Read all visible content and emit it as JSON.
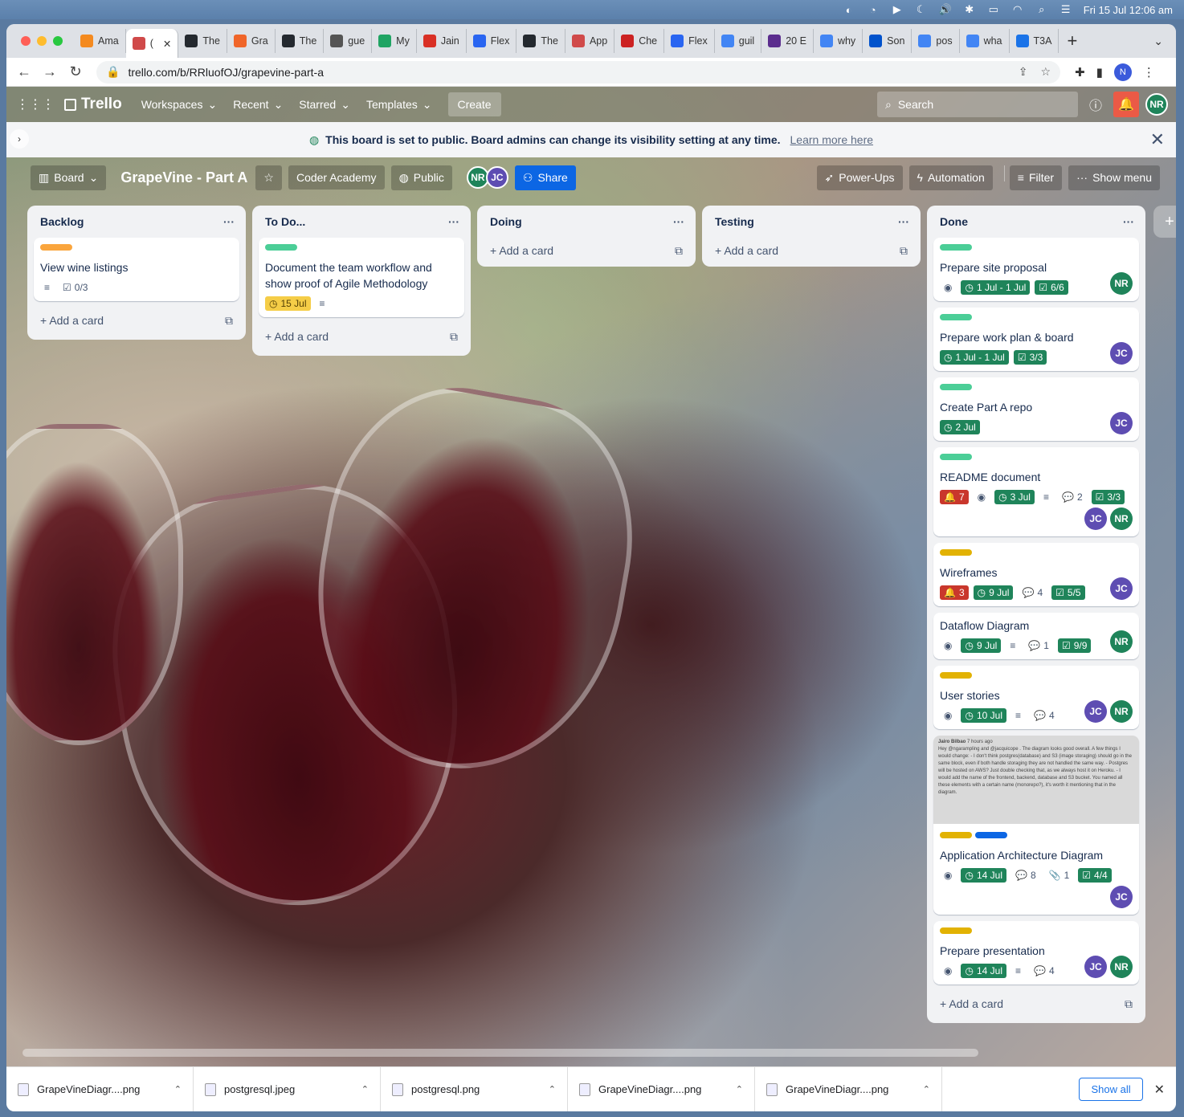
{
  "menubar": {
    "datetime": "Fri 15 Jul  12:06 am"
  },
  "browser": {
    "tabs": [
      {
        "label": "Ama",
        "color": "#f48a1f"
      },
      {
        "label": "(",
        "color": "#d04a4a",
        "active": true
      },
      {
        "label": "The",
        "color": "#24292f"
      },
      {
        "label": "Gra",
        "color": "#f06529"
      },
      {
        "label": "The",
        "color": "#24292f"
      },
      {
        "label": "gue",
        "color": "#555555"
      },
      {
        "label": "My",
        "color": "#1fa463"
      },
      {
        "label": "Jain",
        "color": "#d93025"
      },
      {
        "label": "Flex",
        "color": "#2965f1"
      },
      {
        "label": "The",
        "color": "#24292f"
      },
      {
        "label": "App",
        "color": "#d04a4a"
      },
      {
        "label": "Che",
        "color": "#cc2222"
      },
      {
        "label": "Flex",
        "color": "#2965f1"
      },
      {
        "label": "guil",
        "color": "#4285f4"
      },
      {
        "label": "20 E",
        "color": "#5b2d8e"
      },
      {
        "label": "why",
        "color": "#4285f4"
      },
      {
        "label": "Son",
        "color": "#0052cc"
      },
      {
        "label": "pos",
        "color": "#4285f4"
      },
      {
        "label": "wha",
        "color": "#4285f4"
      },
      {
        "label": "T3A",
        "color": "#1a73e8"
      }
    ],
    "url": "trello.com/b/RRluofOJ/grapevine-part-a",
    "profile_initial": "N"
  },
  "trello": {
    "logo": "Trello",
    "nav": {
      "workspaces": "Workspaces",
      "recent": "Recent",
      "starred": "Starred",
      "templates": "Templates",
      "create": "Create"
    },
    "search_placeholder": "Search",
    "user": "NR",
    "banner": {
      "text": "This board is set to public. Board admins can change its visibility setting at any time.",
      "link": "Learn more here"
    },
    "board": {
      "view": "Board",
      "title": "GrapeVine - Part A",
      "workspace": "Coder Academy",
      "visibility": "Public",
      "members": [
        "NR",
        "JC"
      ],
      "share": "Share",
      "powerups": "Power-Ups",
      "automation": "Automation",
      "filter": "Filter",
      "menu": "Show menu"
    },
    "add_card": "Add a card",
    "lists": {
      "backlog": {
        "title": "Backlog",
        "card": {
          "title": "View wine listings",
          "checklist": "0/3"
        }
      },
      "todo": {
        "title": "To Do...",
        "card": {
          "title": "Document the team workflow and show proof of Agile Methodology",
          "due": "15 Jul"
        }
      },
      "doing": {
        "title": "Doing"
      },
      "testing": {
        "title": "Testing"
      },
      "done": {
        "title": "Done",
        "cards": {
          "c1": {
            "title": "Prepare site proposal",
            "due": "1 Jul - 1 Jul",
            "checklist": "6/6",
            "member": "NR"
          },
          "c2": {
            "title": "Prepare work plan & board",
            "due": "1 Jul - 1 Jul",
            "checklist": "3/3",
            "member": "JC"
          },
          "c3": {
            "title": "Create Part A repo",
            "due": "2 Jul",
            "member": "JC"
          },
          "c4": {
            "title": "README document",
            "notif": "7",
            "due": "3 Jul",
            "comments": "2",
            "checklist": "3/3",
            "m1": "JC",
            "m2": "NR"
          },
          "c5": {
            "title": "Wireframes",
            "notif": "3",
            "due": "9 Jul",
            "comments": "4",
            "checklist": "5/5",
            "member": "JC"
          },
          "c6": {
            "title": "Dataflow Diagram",
            "due": "9 Jul",
            "comments": "1",
            "checklist": "9/9",
            "member": "NR"
          },
          "c7": {
            "title": "User stories",
            "due": "10 Jul",
            "comments": "4",
            "m1": "JC",
            "m2": "NR"
          },
          "c8": {
            "thumb_author": "Jairo Bilbao",
            "thumb_time": "7 hours ago",
            "thumb_text": "Hey @ngarampling and @jacquicope . The diagram looks good overall. A few things I would change: - I don't think postgres(database) and S3 (image storaging) should go in the same block, even if both handle storaging they are not handled the same way. - Postgres will be hosted on AWS? Just double checking that, as we always host it on Heroku. - I would add the name of the frontend, backend, database and S3 bucket. You named all these elements with a certain name (monorepo?), it's worth it mentioning that in the diagram.",
            "title": "Application Architecture Diagram",
            "due": "14 Jul",
            "comments": "8",
            "attachments": "1",
            "checklist": "4/4",
            "member": "JC"
          },
          "c9": {
            "title": "Prepare presentation",
            "due": "14 Jul",
            "comments": "4",
            "m1": "JC",
            "m2": "NR"
          }
        }
      }
    }
  },
  "downloads": {
    "items": [
      "GrapeVineDiagr....png",
      "postgresql.jpeg",
      "postgresql.png",
      "GrapeVineDiagr....png",
      "GrapeVineDiagr....png"
    ],
    "show_all": "Show all"
  }
}
